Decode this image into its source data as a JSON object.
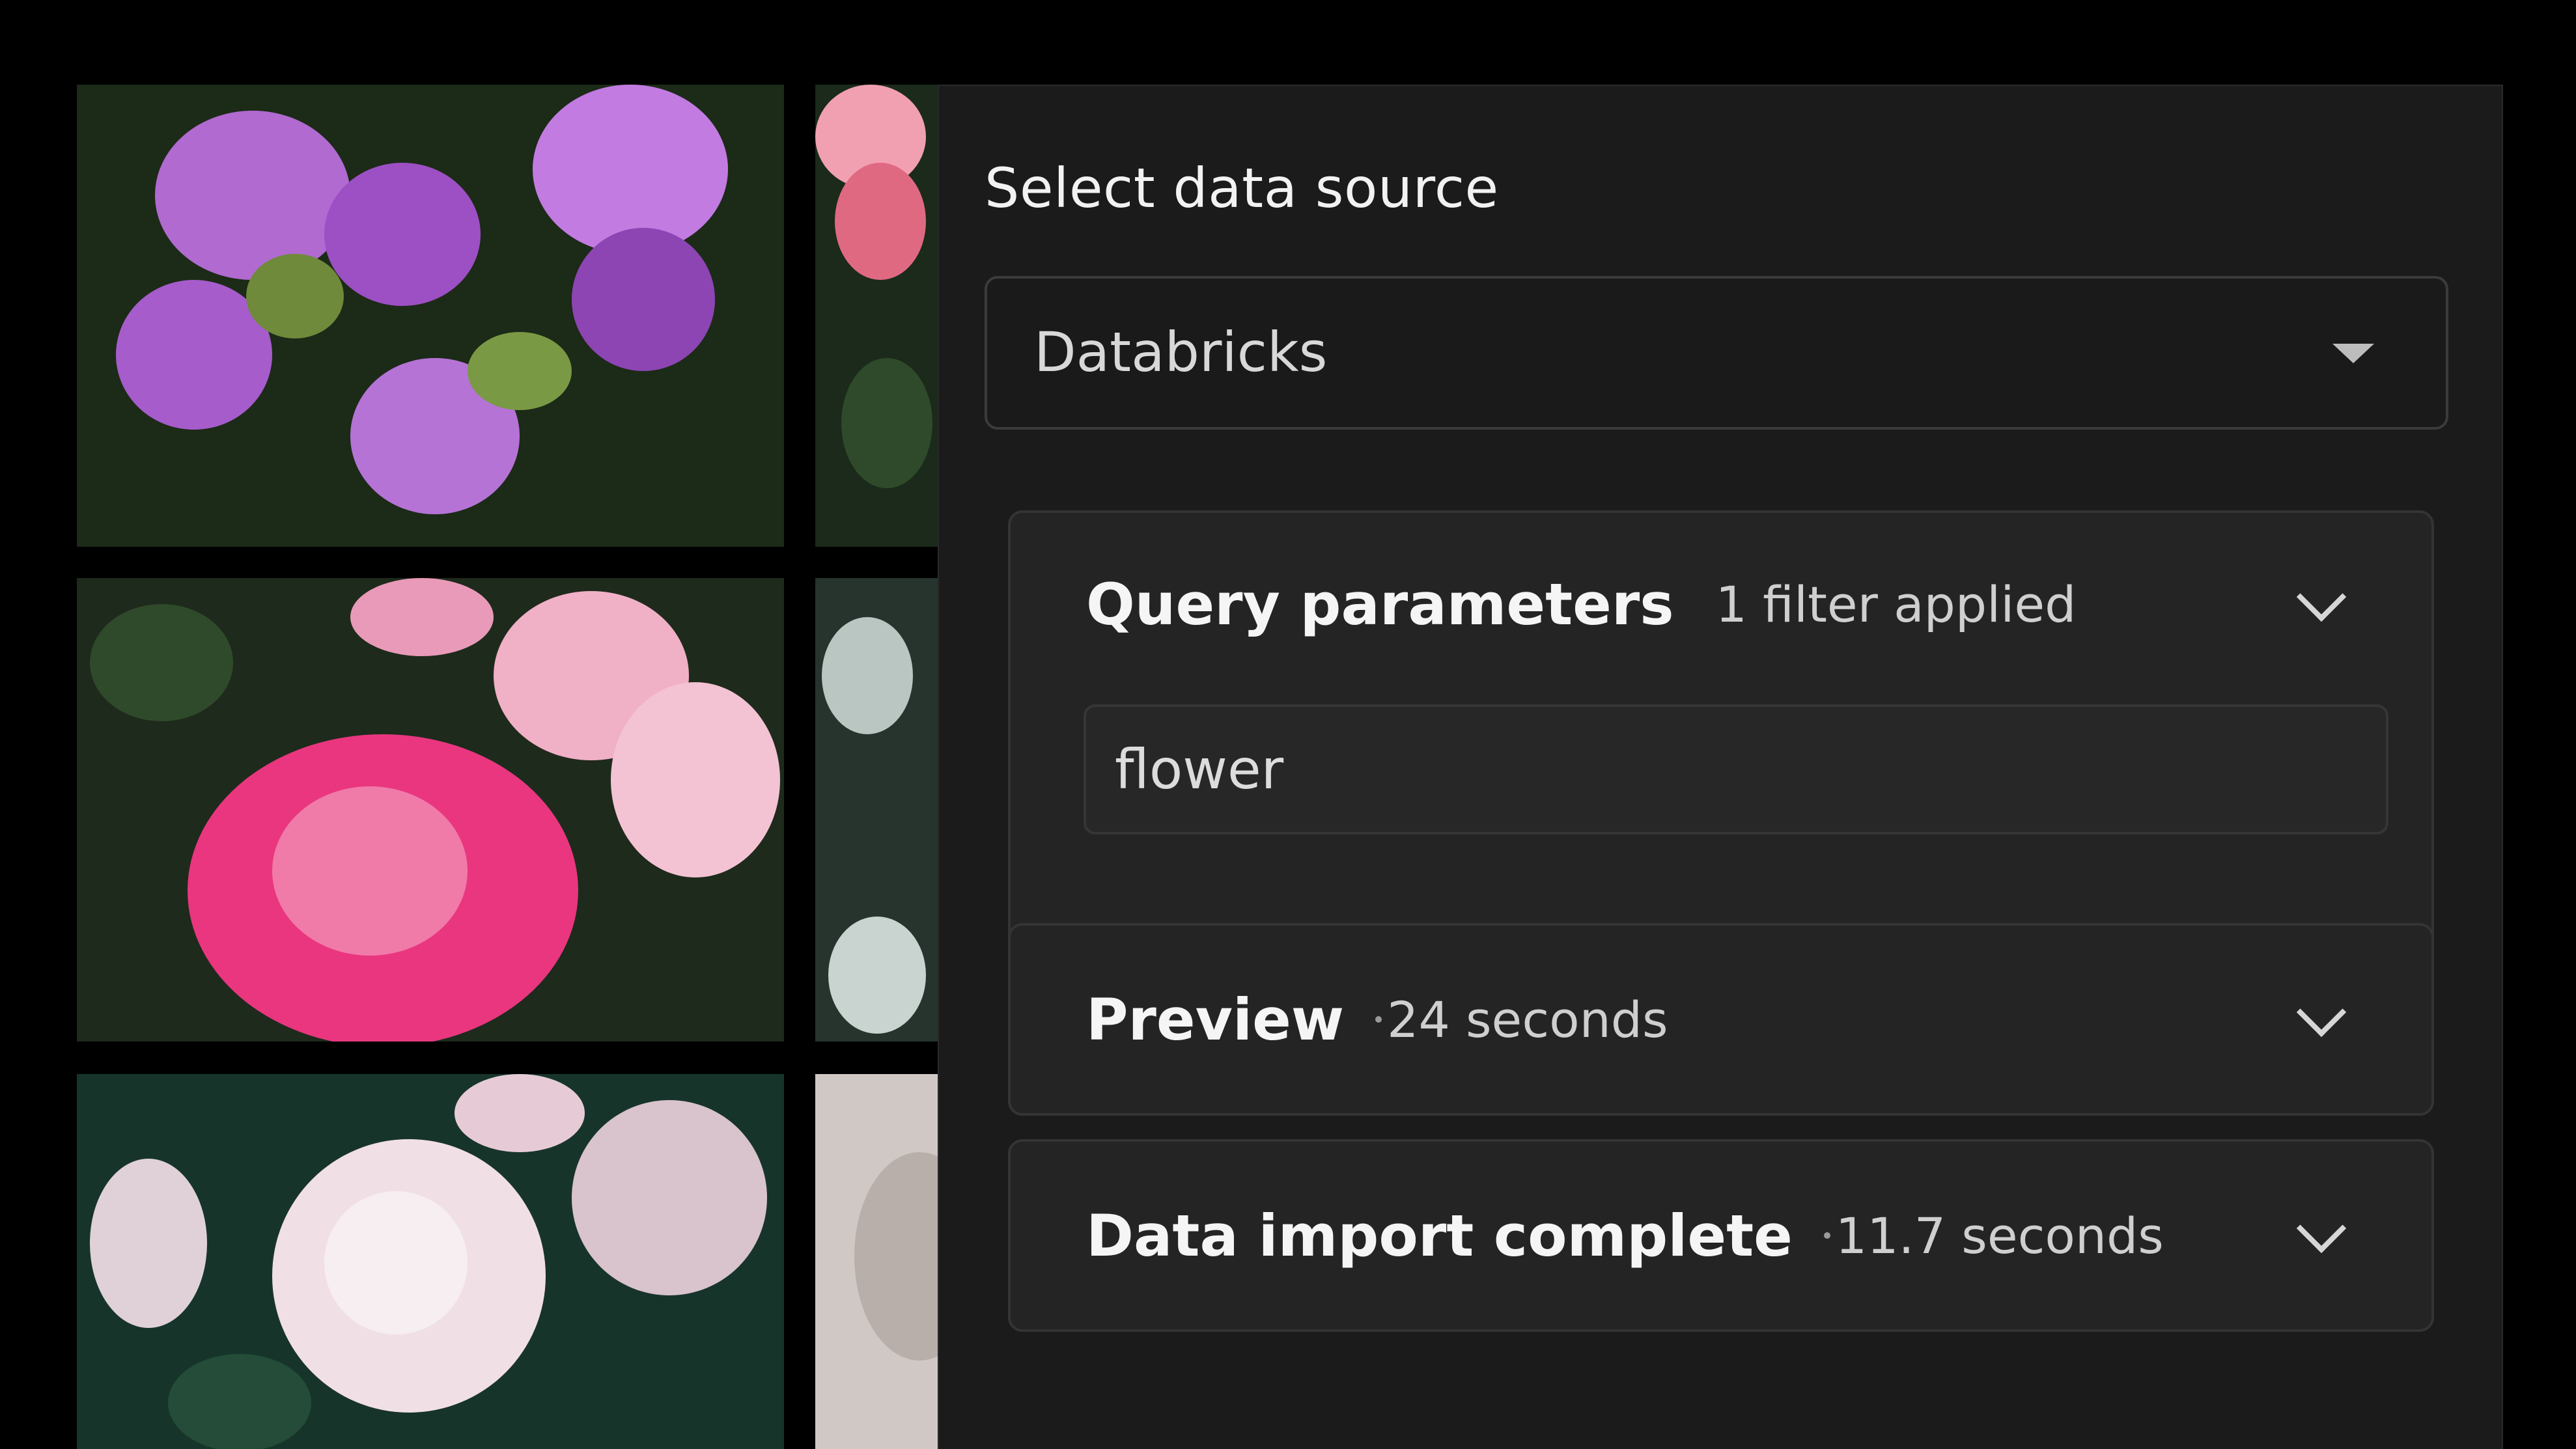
{
  "panel": {
    "title": "Select data source",
    "source_select": {
      "value": "Databricks"
    },
    "query_parameters": {
      "title": "Query parameters",
      "meta": "1 filter applied",
      "filter_value": "flower"
    },
    "preview": {
      "title": "Preview",
      "meta": "24 seconds"
    },
    "data_import": {
      "title": "Data import complete",
      "meta": "11.7 seconds"
    }
  },
  "colors": {
    "panel_bg": "#1b1b1b",
    "card_bg": "#242424",
    "text_primary": "#f5f5f5",
    "text_secondary": "#cfcfcf"
  },
  "icons": {
    "select_caret": "caret-down-icon",
    "card_toggle": "chevron-down-icon"
  }
}
